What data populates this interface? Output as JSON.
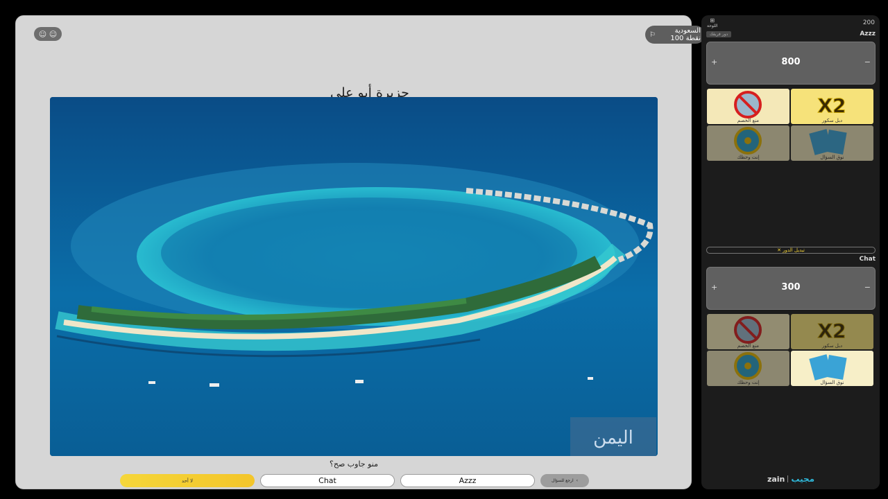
{
  "window": {
    "controls": "☺ ☺"
  },
  "team_badge": {
    "country": "السعودية",
    "points": "100 نقطة",
    "flag_icon": "⚐"
  },
  "question": {
    "title": "جزيرة أبو علي",
    "watermark": "اليمن",
    "who_answered": "منو جاوب صح؟"
  },
  "answer_buttons": {
    "no_one": "لا أحد",
    "team2": "Chat",
    "team1": "Azzz",
    "back": "ارجع للسؤال",
    "back_icon": "‹"
  },
  "sidebar": {
    "top_left_icon": "⊞",
    "top_left_label": "اللوحة",
    "top_right_value": "200",
    "switch_turn": "✕ تبديل الدور",
    "brand_logo": "مجيب",
    "partner_logo": "zain",
    "teams": [
      {
        "name": "Azzz",
        "tag": "دور فريقك",
        "score": "800",
        "plus": "+",
        "minus": "−",
        "powers": [
          {
            "label": "دبل سكور",
            "icon": "x2-icon",
            "text": "X2",
            "used": false
          },
          {
            "label": "منع الخصم",
            "icon": "block-opponent-icon",
            "used": false
          },
          {
            "label": "نوق السؤال",
            "icon": "cards-icon",
            "used": true
          },
          {
            "label": "إنت وحظك",
            "icon": "wheel-icon",
            "used": true
          }
        ]
      },
      {
        "name": "Chat",
        "score": "300",
        "plus": "+",
        "minus": "−",
        "powers": [
          {
            "label": "دبل سكور",
            "icon": "x2-icon",
            "text": "X2",
            "used": true
          },
          {
            "label": "منع الخصم",
            "icon": "block-opponent-icon",
            "used": true
          },
          {
            "label": "نوق السؤال",
            "icon": "cards-icon",
            "used": false
          },
          {
            "label": "إنت وحظك",
            "icon": "wheel-icon",
            "used": true
          }
        ]
      }
    ]
  }
}
